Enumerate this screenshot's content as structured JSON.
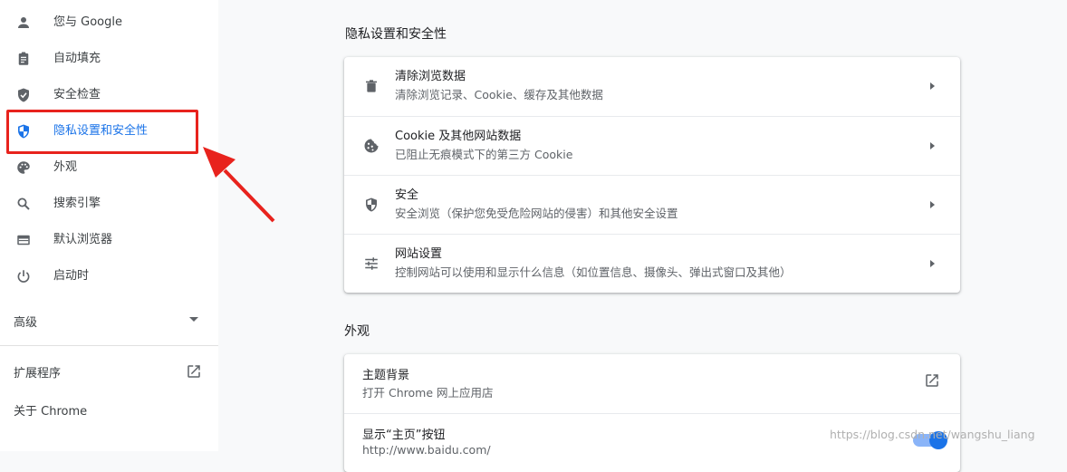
{
  "sidebar": {
    "items": [
      {
        "label": "您与 Google",
        "icon": "person-icon"
      },
      {
        "label": "自动填充",
        "icon": "clipboard-icon"
      },
      {
        "label": "安全检查",
        "icon": "shield-check-icon"
      },
      {
        "label": "隐私设置和安全性",
        "icon": "shield-half-icon",
        "active": true
      },
      {
        "label": "外观",
        "icon": "palette-icon"
      },
      {
        "label": "搜索引擎",
        "icon": "search-icon"
      },
      {
        "label": "默认浏览器",
        "icon": "browser-icon"
      },
      {
        "label": "启动时",
        "icon": "power-icon"
      }
    ],
    "advanced_label": "高级",
    "extensions_label": "扩展程序",
    "about_label": "关于 Chrome"
  },
  "privacy": {
    "section_title": "隐私设置和安全性",
    "rows": [
      {
        "title": "清除浏览数据",
        "subtitle": "清除浏览记录、Cookie、缓存及其他数据",
        "icon": "trash-icon"
      },
      {
        "title": "Cookie 及其他网站数据",
        "subtitle": "已阻止无痕模式下的第三方 Cookie",
        "icon": "cookie-icon"
      },
      {
        "title": "安全",
        "subtitle": "安全浏览（保护您免受危险网站的侵害）和其他安全设置",
        "icon": "shield-icon"
      },
      {
        "title": "网站设置",
        "subtitle": "控制网站可以使用和显示什么信息（如位置信息、摄像头、弹出式窗口及其他）",
        "icon": "tune-icon"
      }
    ]
  },
  "appearance": {
    "section_title": "外观",
    "theme_title": "主题背景",
    "theme_subtitle": "打开 Chrome 网上应用店",
    "home_title": "显示“主页”按钮",
    "home_subtitle": "http://www.baidu.com/",
    "home_enabled": true
  },
  "watermark": "https://blog.csdn.net/wangshu_liang",
  "colors": {
    "accent": "#1a73e8",
    "annotation": "#e8231d"
  }
}
